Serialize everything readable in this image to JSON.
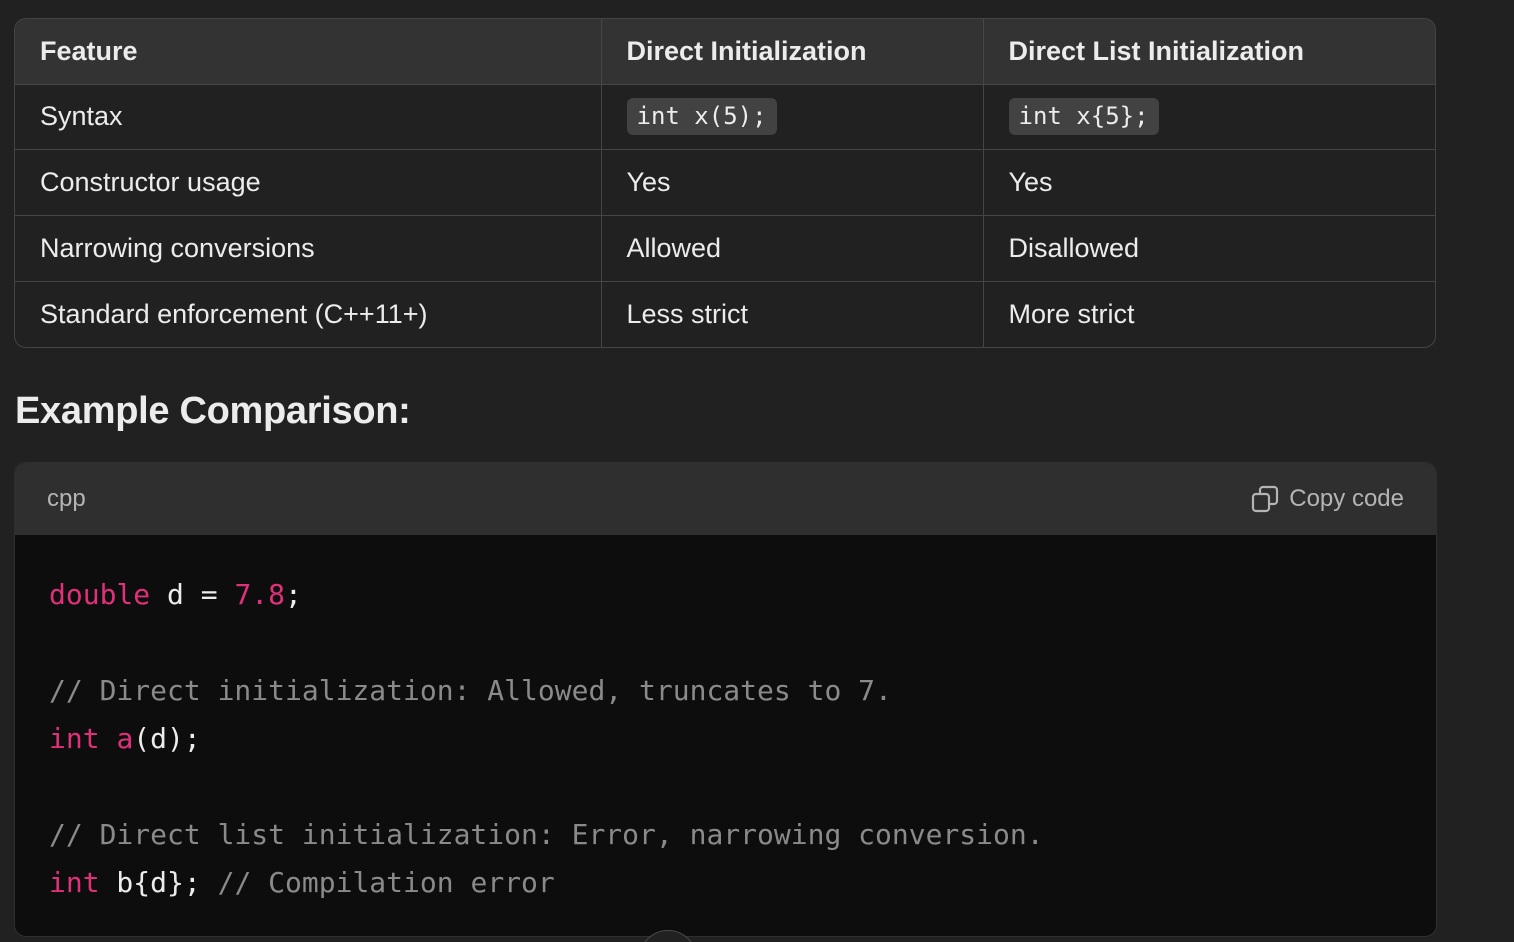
{
  "table": {
    "headers": [
      "Feature",
      "Direct Initialization",
      "Direct List Initialization"
    ],
    "rows": [
      [
        "Syntax",
        "int x(5);",
        "int x{5};"
      ],
      [
        "Constructor usage",
        "Yes",
        "Yes"
      ],
      [
        "Narrowing conversions",
        "Allowed",
        "Disallowed"
      ],
      [
        "Standard enforcement (C++11+)",
        "Less strict",
        "More strict"
      ]
    ]
  },
  "heading": "Example Comparison:",
  "code_block": {
    "language": "cpp",
    "copy_label": "Copy code",
    "icons": {
      "copy": "copy-icon",
      "scroll_down": "scroll-down-button"
    },
    "colors": {
      "keyword": "#df3079",
      "comment": "#8a8a8a",
      "text": "#ececec",
      "background": "#0d0d0d"
    },
    "lines": [
      [
        [
          "kw",
          "double"
        ],
        [
          "pl",
          " d = "
        ],
        [
          "num",
          "7.8"
        ],
        [
          "pl",
          ";"
        ]
      ],
      [],
      [
        [
          "cm",
          "// Direct initialization: Allowed, truncates to 7."
        ]
      ],
      [
        [
          "kw",
          "int"
        ],
        [
          "pl",
          " "
        ],
        [
          "fn",
          "a"
        ],
        [
          "pl",
          "(d);"
        ]
      ],
      [],
      [
        [
          "cm",
          "// Direct list initialization: Error, narrowing conversion."
        ]
      ],
      [
        [
          "kw",
          "int"
        ],
        [
          "pl",
          " b{d}; "
        ],
        [
          "cm",
          "// Compilation error"
        ]
      ]
    ]
  }
}
